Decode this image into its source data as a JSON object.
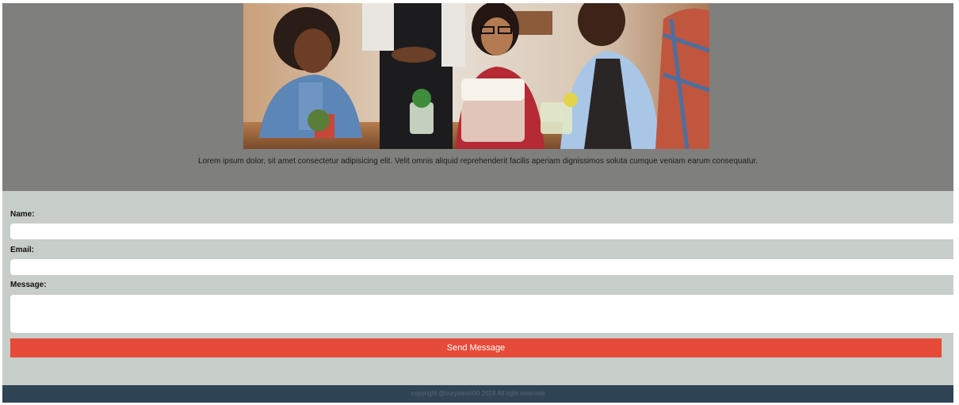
{
  "hero": {
    "image_icon": "photo-friends-in-cafe",
    "description": "Lorem ipsum dolor, sit amet consectetur adipisicing elit. Velit omnis aliquid reprehenderit facilis aperiam dignissimos soluta cumque veniam earum consequatur."
  },
  "form": {
    "name_label": "Name:",
    "name_value": "",
    "email_label": "Email:",
    "email_value": "",
    "message_label": "Message:",
    "message_value": "",
    "submit_label": "Send Message"
  },
  "footer": {
    "copyright": "copyright @suryatesh00 2024 All right reserved"
  },
  "colors": {
    "hero_bg": "#7f7f7d",
    "form_bg": "#c7cdc9",
    "button": "#e54b38",
    "footer_bg": "#2f4455"
  }
}
